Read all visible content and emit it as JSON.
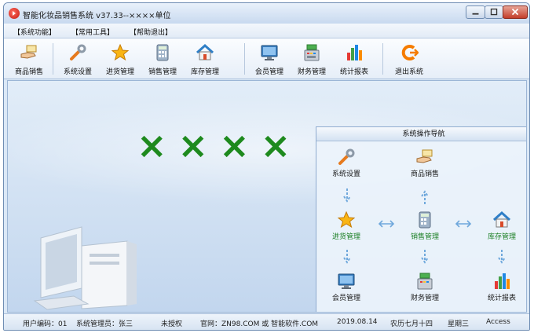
{
  "window": {
    "title": "智能化妆品销售系统 v37.33--××××单位",
    "colors": {
      "title_bg": "#c8d9ef",
      "accent_green": "#1e8a1e",
      "close_red": "#c33e2b"
    }
  },
  "menu": [
    {
      "label": "【系统功能】"
    },
    {
      "label": "【常用工具】"
    },
    {
      "label": "【帮助退出】"
    }
  ],
  "toolbar": [
    {
      "label": "商品销售",
      "icon": "hand-money-icon"
    },
    {
      "label": "系统设置",
      "icon": "wrench-icon"
    },
    {
      "label": "进货管理",
      "icon": "star-icon"
    },
    {
      "label": "销售管理",
      "icon": "calculator-icon"
    },
    {
      "label": "库存管理",
      "icon": "house-icon"
    },
    {
      "label": "会员管理",
      "icon": "monitor-icon"
    },
    {
      "label": "财务管理",
      "icon": "cash-register-icon"
    },
    {
      "label": "统计报表",
      "icon": "bar-chart-icon"
    },
    {
      "label": "退出系统",
      "icon": "exit-arrow-icon"
    }
  ],
  "brand": {
    "text": "××××"
  },
  "nav": {
    "title": "系统操作导航",
    "nodes": {
      "settings": {
        "label": "系统设置",
        "icon": "wrench-icon"
      },
      "sales": {
        "label": "商品销售",
        "icon": "hand-money-icon"
      },
      "purchase": {
        "label": "进货管理",
        "icon": "star-icon"
      },
      "sales_mgmt": {
        "label": "销售管理",
        "icon": "calculator-icon"
      },
      "inventory": {
        "label": "库存管理",
        "icon": "house-icon"
      },
      "member": {
        "label": "会员管理",
        "icon": "monitor-icon"
      },
      "finance": {
        "label": "财务管理",
        "icon": "cash-register-icon"
      },
      "report": {
        "label": "统计报表",
        "icon": "bar-chart-icon"
      }
    }
  },
  "status": {
    "user_code": "用户编码：01",
    "operator": "系统管理员：张三",
    "license": "未授权",
    "website": "官网：ZN98.COM 或 智能软件.COM",
    "date": "2019.08.14",
    "lunar": "农历七月十四",
    "weekday": "星期三",
    "db": "Access"
  }
}
